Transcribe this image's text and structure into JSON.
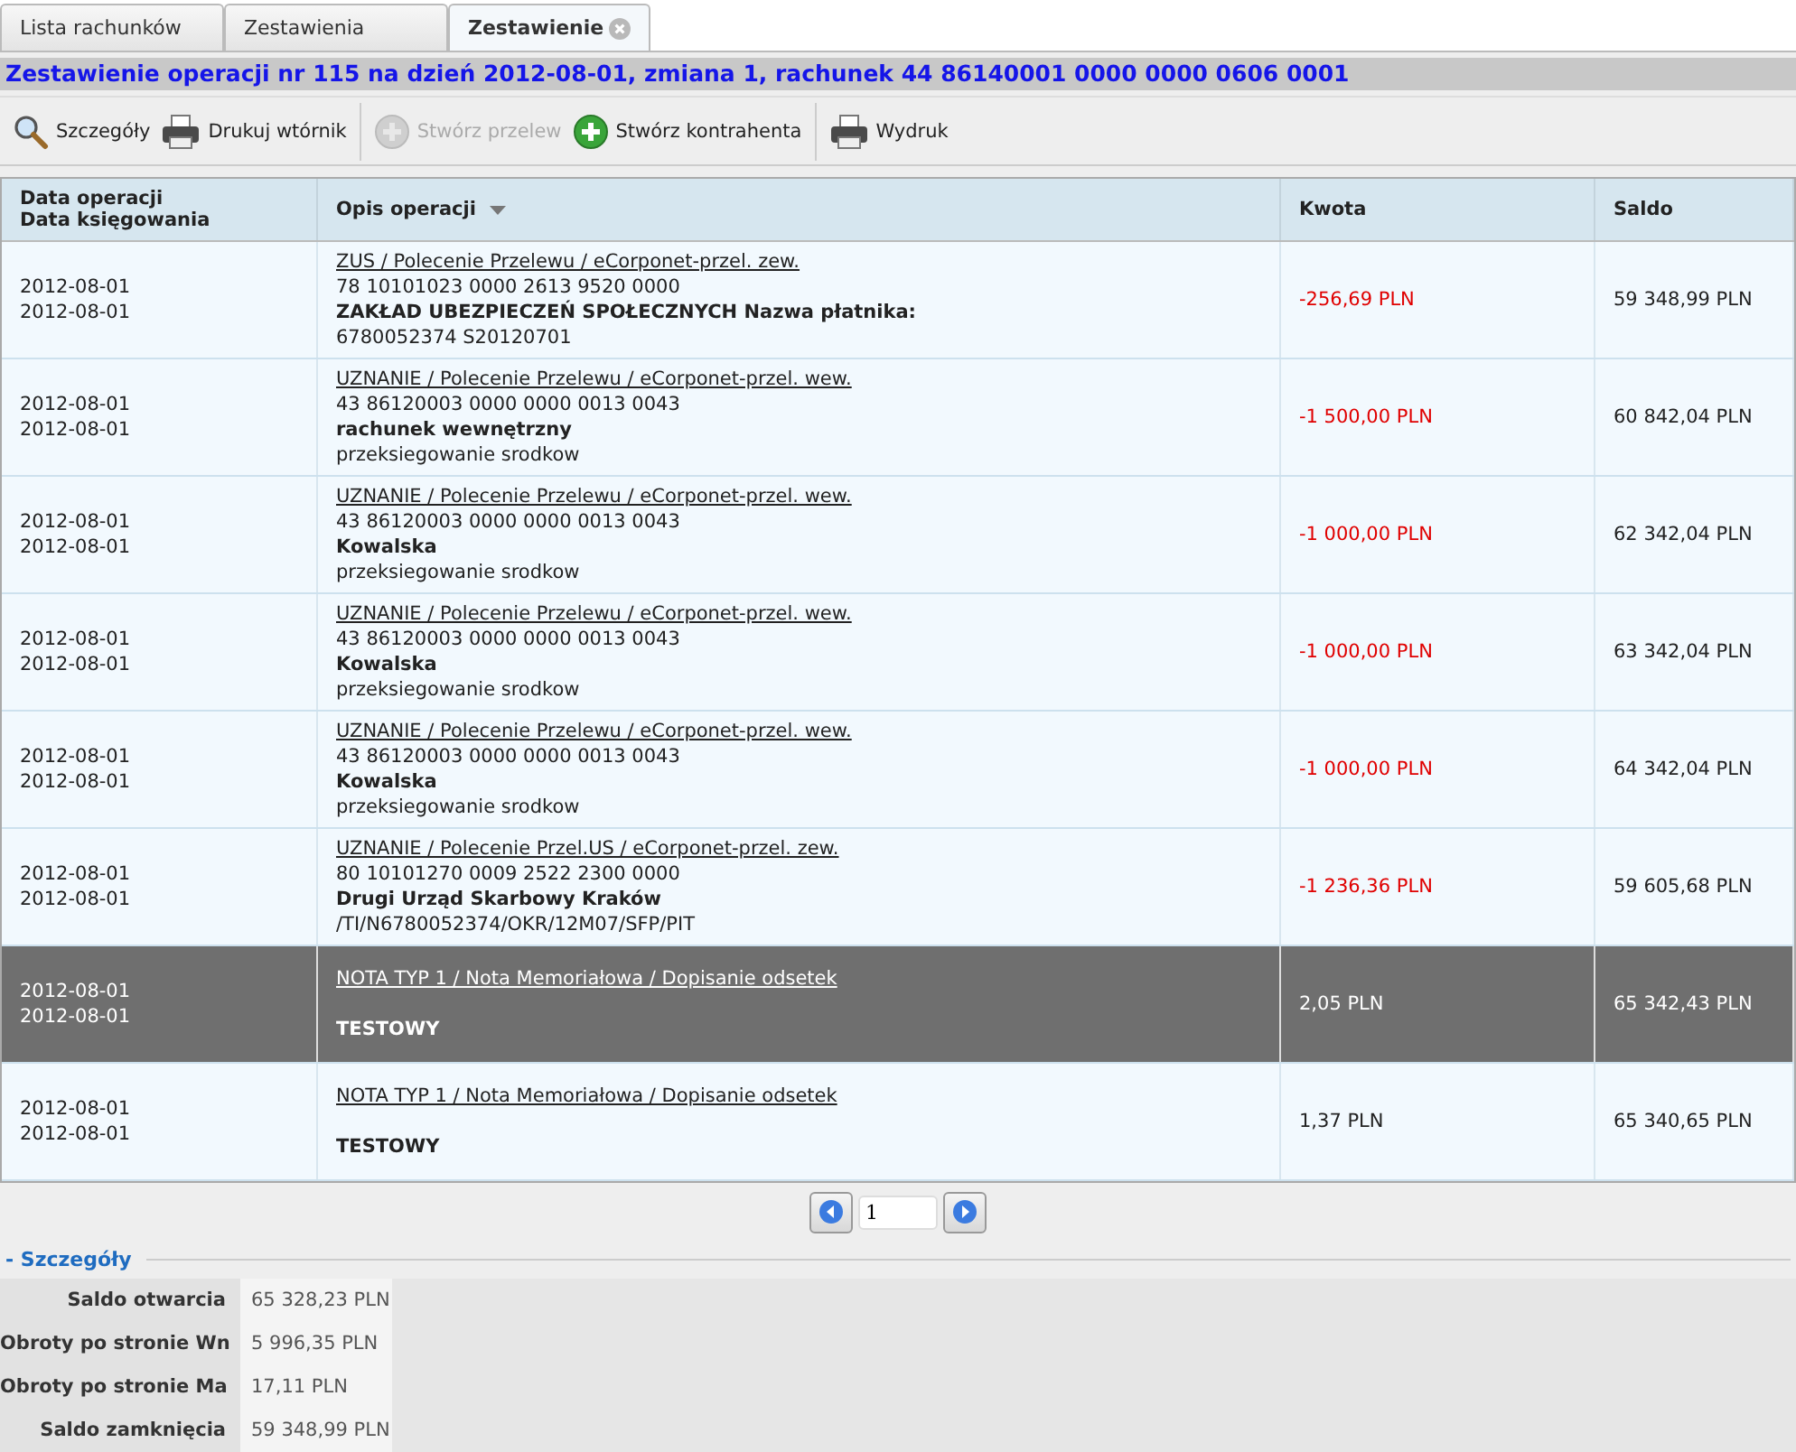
{
  "tabs": [
    {
      "label": "Lista rachunków",
      "selected": false,
      "closable": false
    },
    {
      "label": "Zestawienia",
      "selected": false,
      "closable": false
    },
    {
      "label": "Zestawienie",
      "selected": true,
      "closable": true
    }
  ],
  "title": "Zestawienie operacji nr 115 na dzień 2012-08-01, zmiana 1, rachunek 44 86140001 0000 0000 0606 0001",
  "toolbar": [
    {
      "label": "Szczegóły",
      "kind": "search",
      "disabled": false,
      "separator_after": false
    },
    {
      "label": "Drukuj wtórnik",
      "kind": "print",
      "disabled": false,
      "separator_after": true
    },
    {
      "label": "Stwórz przelew",
      "kind": "create",
      "disabled": true,
      "separator_after": false
    },
    {
      "label": "Stwórz kontrahenta",
      "kind": "create",
      "disabled": false,
      "separator_after": true
    },
    {
      "label": "Wydruk",
      "kind": "print",
      "disabled": false,
      "separator_after": false
    }
  ],
  "table": {
    "columns": [
      {
        "lines": [
          "Data operacji",
          "Data księgowania"
        ],
        "sorted": false
      },
      {
        "lines": [
          "Opis operacji"
        ],
        "sorted": true
      },
      {
        "lines": [
          "Kwota"
        ],
        "sorted": false
      },
      {
        "lines": [
          "Saldo"
        ],
        "sorted": false
      }
    ],
    "rows": [
      {
        "selected": false,
        "dates": [
          "2012-08-01",
          "2012-08-01"
        ],
        "lines": [
          {
            "kind": "link",
            "text": "ZUS / Polecenie Przelewu / eCorponet-przel. zew."
          },
          {
            "kind": "text",
            "text": "78 10101023 0000 2613 9520 0000"
          },
          {
            "kind": "bold",
            "text": "ZAKŁAD UBEZPIECZEŃ SPOŁECZNYCH Nazwa płatnika:"
          },
          {
            "kind": "text",
            "text": "6780052374 S20120701"
          }
        ],
        "amount": "-256,69 PLN",
        "negative": true,
        "balance": "59 348,99 PLN"
      },
      {
        "selected": false,
        "dates": [
          "2012-08-01",
          "2012-08-01"
        ],
        "lines": [
          {
            "kind": "link",
            "text": "UZNANIE / Polecenie Przelewu / eCorponet-przel. wew."
          },
          {
            "kind": "text",
            "text": "43 86120003 0000 0000 0013 0043"
          },
          {
            "kind": "bold",
            "text": "rachunek wewnętrzny"
          },
          {
            "kind": "text",
            "text": "przeksiegowanie srodkow"
          }
        ],
        "amount": "-1 500,00 PLN",
        "negative": true,
        "balance": "60 842,04 PLN"
      },
      {
        "selected": false,
        "dates": [
          "2012-08-01",
          "2012-08-01"
        ],
        "lines": [
          {
            "kind": "link",
            "text": "UZNANIE / Polecenie Przelewu / eCorponet-przel. wew."
          },
          {
            "kind": "text",
            "text": "43 86120003 0000 0000 0013 0043"
          },
          {
            "kind": "bold",
            "text": "Kowalska"
          },
          {
            "kind": "text",
            "text": "przeksiegowanie srodkow"
          }
        ],
        "amount": "-1 000,00 PLN",
        "negative": true,
        "balance": "62 342,04 PLN"
      },
      {
        "selected": false,
        "dates": [
          "2012-08-01",
          "2012-08-01"
        ],
        "lines": [
          {
            "kind": "link",
            "text": "UZNANIE / Polecenie Przelewu / eCorponet-przel. wew."
          },
          {
            "kind": "text",
            "text": "43 86120003 0000 0000 0013 0043"
          },
          {
            "kind": "bold",
            "text": "Kowalska"
          },
          {
            "kind": "text",
            "text": "przeksiegowanie srodkow"
          }
        ],
        "amount": "-1 000,00 PLN",
        "negative": true,
        "balance": "63 342,04 PLN"
      },
      {
        "selected": false,
        "dates": [
          "2012-08-01",
          "2012-08-01"
        ],
        "lines": [
          {
            "kind": "link",
            "text": "UZNANIE / Polecenie Przelewu / eCorponet-przel. wew."
          },
          {
            "kind": "text",
            "text": "43 86120003 0000 0000 0013 0043"
          },
          {
            "kind": "bold",
            "text": "Kowalska"
          },
          {
            "kind": "text",
            "text": "przeksiegowanie srodkow"
          }
        ],
        "amount": "-1 000,00 PLN",
        "negative": true,
        "balance": "64 342,04 PLN"
      },
      {
        "selected": false,
        "dates": [
          "2012-08-01",
          "2012-08-01"
        ],
        "lines": [
          {
            "kind": "link",
            "text": "UZNANIE / Polecenie Przel.US / eCorponet-przel. zew."
          },
          {
            "kind": "text",
            "text": "80 10101270 0009 2522 2300 0000"
          },
          {
            "kind": "bold",
            "text": "Drugi Urząd Skarbowy Kraków"
          },
          {
            "kind": "text",
            "text": "/TI/N6780052374/OKR/12M07/SFP/PIT"
          }
        ],
        "amount": "-1 236,36 PLN",
        "negative": true,
        "balance": "59 605,68 PLN"
      },
      {
        "selected": true,
        "dates": [
          "2012-08-01",
          "2012-08-01"
        ],
        "lines": [
          {
            "kind": "link",
            "text": "NOTA TYP 1 / Nota Memoriałowa / Dopisanie odsetek"
          },
          {
            "kind": "bold",
            "text": "TESTOWY"
          }
        ],
        "amount": "2,05 PLN",
        "negative": false,
        "balance": "65 342,43 PLN"
      },
      {
        "selected": false,
        "dates": [
          "2012-08-01",
          "2012-08-01"
        ],
        "lines": [
          {
            "kind": "link",
            "text": "NOTA TYP 1 / Nota Memoriałowa / Dopisanie odsetek"
          },
          {
            "kind": "bold",
            "text": "TESTOWY"
          }
        ],
        "amount": "1,37 PLN",
        "negative": false,
        "balance": "65 340,65 PLN"
      }
    ]
  },
  "pager": {
    "page": "1"
  },
  "details": {
    "title": "- Szczegóły",
    "rows": [
      {
        "label": "Saldo otwarcia",
        "value": "65 328,23 PLN"
      },
      {
        "label": "Obroty po stronie Wn",
        "value": "5 996,35 PLN"
      },
      {
        "label": "Obroty po stronie Ma",
        "value": "17,11 PLN"
      },
      {
        "label": "Saldo zamknięcia",
        "value": "59 348,99 PLN"
      }
    ]
  }
}
